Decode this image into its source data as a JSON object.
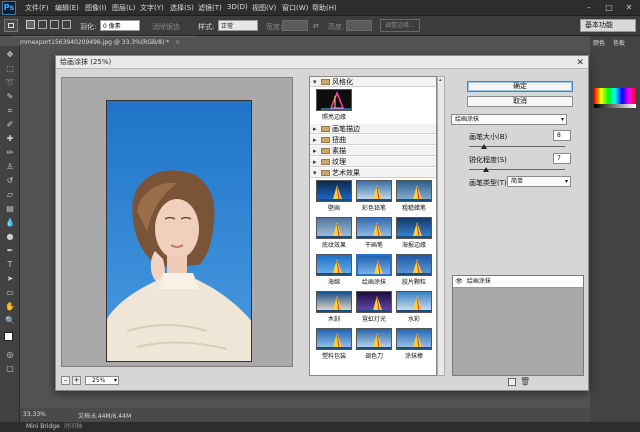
{
  "app": {
    "logo": "Ps",
    "menu": [
      "文件(F)",
      "编辑(E)",
      "图像(I)",
      "图层(L)",
      "文字(Y)",
      "选择(S)",
      "滤镜(T)",
      "3D(D)",
      "视图(V)",
      "窗口(W)",
      "帮助(H)"
    ],
    "window_controls": [
      "–",
      "□",
      "✕"
    ]
  },
  "options_bar": {
    "feather_label": "羽化:",
    "feather_value": "0 像素",
    "antialias_label": "消除锯齿",
    "style_label": "样式:",
    "style_value": "正常",
    "width_label": "宽度:",
    "height_label": "高度:",
    "refine_edge": "调整边缘...",
    "workspace": "基本功能"
  },
  "document_tab": {
    "title": "mmexport1563940209496.jpg @ 33.3%(RGB/8) *"
  },
  "right_panel": {
    "tabs": [
      "颜色",
      "色板"
    ]
  },
  "status": {
    "zoom": "33.33%",
    "doc_info": "文档:6.44M/6.44M"
  },
  "bottom": {
    "tabs": [
      "Mini Bridge",
      "时间轴"
    ]
  },
  "dialog": {
    "title": "绘画涂抹 (25%)",
    "close": "✕",
    "zoom_value": "25%",
    "zoom_minus": "–",
    "zoom_plus": "+",
    "groups": [
      {
        "name": "风格化",
        "expanded": true
      },
      {
        "name": "画笔描边",
        "expanded": false
      },
      {
        "name": "扭曲",
        "expanded": false
      },
      {
        "name": "素描",
        "expanded": false
      },
      {
        "name": "纹理",
        "expanded": false
      },
      {
        "name": "艺术效果",
        "expanded": true
      }
    ],
    "stylize_filters": [
      "照亮边缘"
    ],
    "artistic_filters": [
      "壁画",
      "彩色铅笔",
      "粗糙蜡笔",
      "底纹效果",
      "干画笔",
      "海报边缘",
      "海绵",
      "绘画涂抹",
      "胶片颗粒",
      "木刻",
      "霓虹灯光",
      "水彩",
      "塑料包装",
      "调色刀",
      "涂抹棒"
    ],
    "selected_filter": "绘画涂抹",
    "ok_label": "确定",
    "cancel_label": "取消",
    "filter_select": "绘画涂抹",
    "brush_size_label": "画笔大小(B)",
    "brush_size_value": "8",
    "brush_size_fraction": 0.16,
    "sharpness_label": "锐化程度(S)",
    "sharpness_value": "7",
    "sharpness_fraction": 0.18,
    "brush_type_label": "画笔类型(T):",
    "brush_type_value": "简单",
    "effect_layer": "绘画涂抹"
  }
}
